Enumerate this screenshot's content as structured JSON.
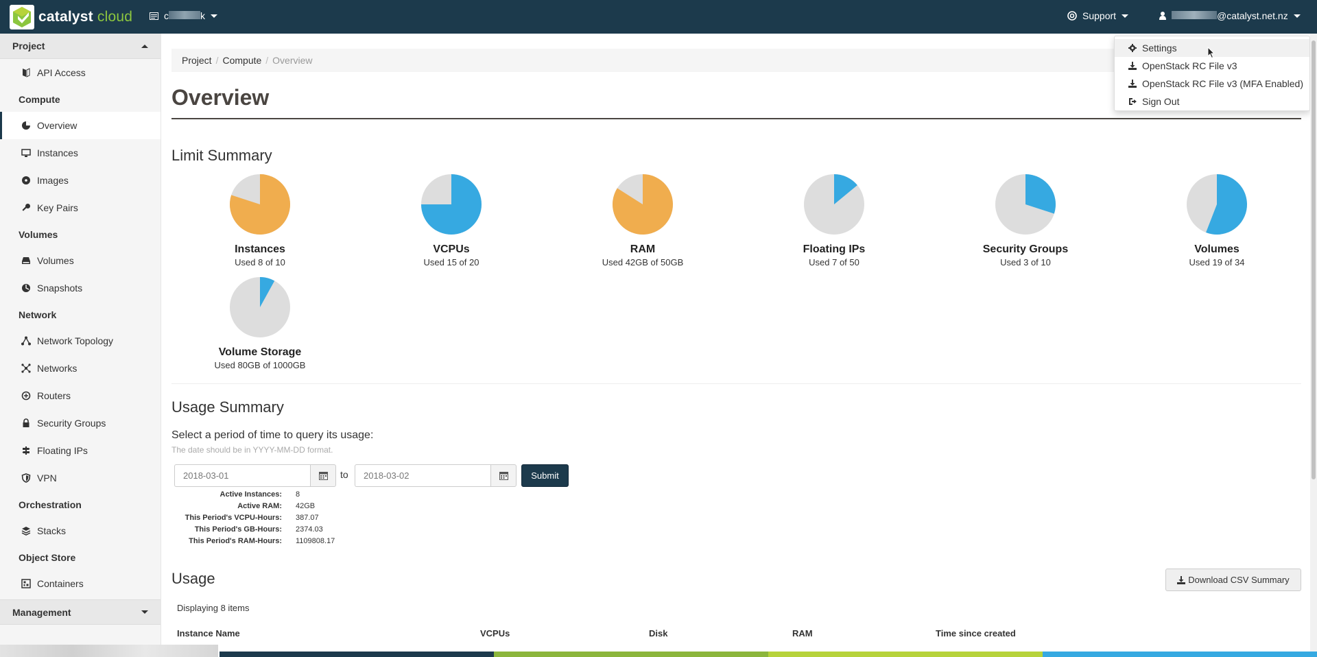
{
  "header": {
    "brand_bold": "catalyst",
    "brand_light": "cloud",
    "project_prefix": "c",
    "project_suffix": "k",
    "support_label": "Support",
    "user_suffix": "@catalyst.net.nz"
  },
  "user_menu": {
    "items": [
      {
        "label": "Settings",
        "icon": "gear-icon"
      },
      {
        "label": "OpenStack RC File v3",
        "icon": "download-icon"
      },
      {
        "label": "OpenStack RC File v3 (MFA Enabled)",
        "icon": "download-icon"
      },
      {
        "label": "Sign Out",
        "icon": "sign-out-icon"
      }
    ]
  },
  "sidebar": {
    "project_label": "Project",
    "api_access": "API Access",
    "compute_label": "Compute",
    "overview": "Overview",
    "instances": "Instances",
    "images": "Images",
    "key_pairs": "Key Pairs",
    "volumes_label": "Volumes",
    "volumes": "Volumes",
    "snapshots": "Snapshots",
    "network_label": "Network",
    "network_topology": "Network Topology",
    "networks": "Networks",
    "routers": "Routers",
    "security_groups": "Security Groups",
    "floating_ips": "Floating IPs",
    "vpn": "VPN",
    "orchestration_label": "Orchestration",
    "stacks": "Stacks",
    "object_store_label": "Object Store",
    "containers": "Containers",
    "management_label": "Management"
  },
  "breadcrumb": {
    "project": "Project",
    "compute": "Compute",
    "current": "Overview"
  },
  "page": {
    "title": "Overview",
    "limit_summary": "Limit Summary",
    "usage_summary": "Usage Summary",
    "query_label": "Select a period of time to query its usage:",
    "date_help": "The date should be in YYYY-MM-DD format.",
    "start_date": "2018-03-01",
    "end_date": "2018-03-02",
    "to_label": "to",
    "submit_label": "Submit",
    "usage_title": "Usage",
    "csv_label": "Download CSV Summary",
    "displaying": "Displaying 8 items"
  },
  "limits": [
    {
      "name": "Instances",
      "text": "Used 8 of 10",
      "used": 8,
      "total": 10,
      "color": "#f0ad4e"
    },
    {
      "name": "VCPUs",
      "text": "Used 15 of 20",
      "used": 15,
      "total": 20,
      "color": "#36a9e1"
    },
    {
      "name": "RAM",
      "text": "Used 42GB of 50GB",
      "used": 42,
      "total": 50,
      "color": "#f0ad4e"
    },
    {
      "name": "Floating IPs",
      "text": "Used 7 of 50",
      "used": 7,
      "total": 50,
      "color": "#36a9e1"
    },
    {
      "name": "Security Groups",
      "text": "Used 3 of 10",
      "used": 3,
      "total": 10,
      "color": "#36a9e1"
    },
    {
      "name": "Volumes",
      "text": "Used 19 of 34",
      "used": 19,
      "total": 34,
      "color": "#36a9e1"
    },
    {
      "name": "Volume Storage",
      "text": "Used 80GB of 1000GB",
      "used": 80,
      "total": 1000,
      "color": "#36a9e1"
    }
  ],
  "usage_stats": [
    {
      "key": "Active Instances:",
      "value": "8"
    },
    {
      "key": "Active RAM:",
      "value": "42GB"
    },
    {
      "key": "This Period's VCPU-Hours:",
      "value": "387.07"
    },
    {
      "key": "This Period's GB-Hours:",
      "value": "2374.03"
    },
    {
      "key": "This Period's RAM-Hours:",
      "value": "1109808.17"
    }
  ],
  "table": {
    "columns": [
      "Instance Name",
      "VCPUs",
      "Disk",
      "RAM",
      "Time since created"
    ]
  },
  "colors": {
    "header_bg": "#1c3a4c",
    "pie_empty": "#dddddd",
    "stripe": [
      "#1c3a4c",
      "#8cb63c",
      "#b7d33b",
      "#36a9e1"
    ]
  }
}
